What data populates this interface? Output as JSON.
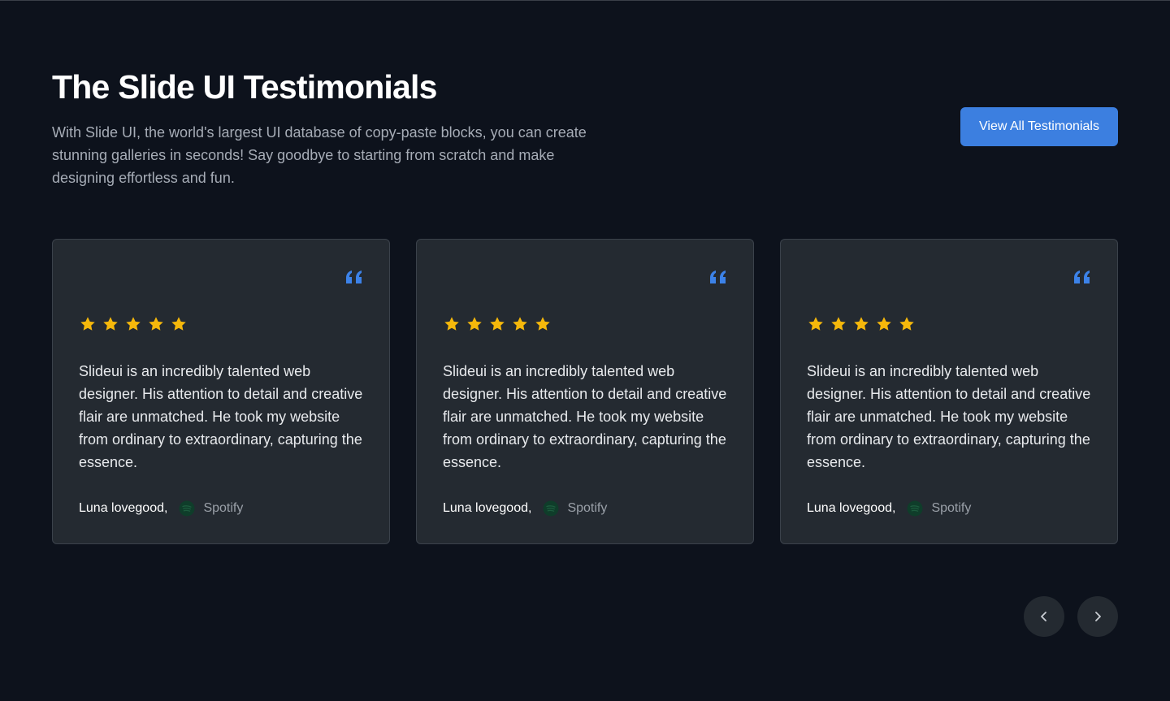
{
  "header": {
    "title": "The Slide UI Testimonials",
    "subtitle": "With Slide UI, the world's largest UI database of copy-paste blocks, you can create stunning galleries in seconds! Say goodbye to starting from scratch and make designing effortless and fun."
  },
  "view_all_label": "View All Testimonials",
  "testimonials": [
    {
      "rating": 5,
      "text": "Slideui is an incredibly talented web designer. His attention to detail and creative flair are unmatched. He took my website from ordinary to extraordinary, capturing the essence.",
      "author": "Luna lovegood,",
      "company": "Spotify",
      "company_icon": "spotify-logo-icon"
    },
    {
      "rating": 5,
      "text": "Slideui is an incredibly talented web designer. His attention to detail and creative flair are unmatched. He took my website from ordinary to extraordinary, capturing the essence.",
      "author": "Luna lovegood,",
      "company": "Spotify",
      "company_icon": "spotify-logo-icon"
    },
    {
      "rating": 5,
      "text": "Slideui is an incredibly talented web designer. His attention to detail and creative flair are unmatched. He took my website from ordinary to extraordinary, capturing the essence.",
      "author": "Luna lovegood,",
      "company": "Spotify",
      "company_icon": "spotify-logo-icon"
    }
  ],
  "nav": {
    "prev_icon": "chevron-left-icon",
    "next_icon": "chevron-right-icon"
  },
  "colors": {
    "background": "#0d121c",
    "card": "#242a31",
    "accent": "#3c7fe0",
    "star": "#f5b80b",
    "quote": "#3c82e8"
  }
}
